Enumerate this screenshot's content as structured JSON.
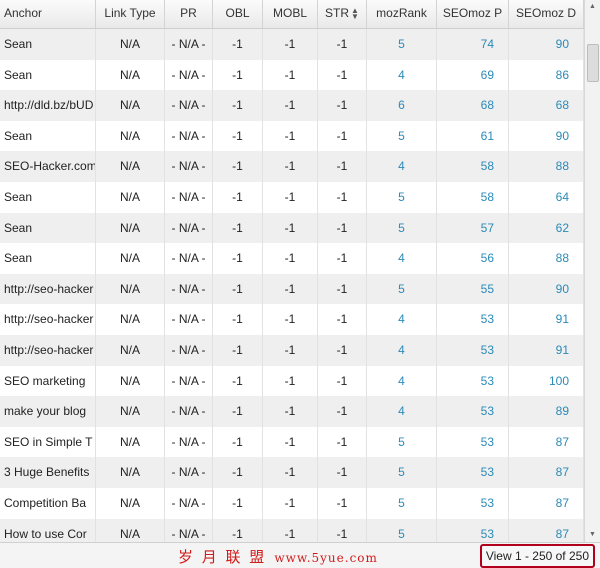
{
  "grid": {
    "columns": [
      {
        "key": "anchor",
        "label": "Anchor",
        "align": "left"
      },
      {
        "key": "link_type",
        "label": "Link Type",
        "align": "center"
      },
      {
        "key": "pr",
        "label": "PR",
        "align": "center"
      },
      {
        "key": "obl",
        "label": "OBL",
        "align": "center"
      },
      {
        "key": "mobl",
        "label": "MOBL",
        "align": "center"
      },
      {
        "key": "str",
        "label": "STR",
        "align": "center",
        "sorted": true
      },
      {
        "key": "mozrank",
        "label": "mozRank",
        "align": "center"
      },
      {
        "key": "seomoz_p",
        "label": "SEOmoz P",
        "align": "right"
      },
      {
        "key": "seomoz_d",
        "label": "SEOmoz D",
        "align": "right"
      }
    ],
    "rows": [
      [
        "Sean",
        "N/A",
        "- N/A -",
        "-1",
        "-1",
        "-1",
        "5",
        "74",
        "90"
      ],
      [
        "Sean",
        "N/A",
        "- N/A -",
        "-1",
        "-1",
        "-1",
        "4",
        "69",
        "86"
      ],
      [
        "http://dld.bz/bUD",
        "N/A",
        "- N/A -",
        "-1",
        "-1",
        "-1",
        "6",
        "68",
        "68"
      ],
      [
        "Sean",
        "N/A",
        "- N/A -",
        "-1",
        "-1",
        "-1",
        "5",
        "61",
        "90"
      ],
      [
        "SEO-Hacker.com",
        "N/A",
        "- N/A -",
        "-1",
        "-1",
        "-1",
        "4",
        "58",
        "88"
      ],
      [
        "Sean",
        "N/A",
        "- N/A -",
        "-1",
        "-1",
        "-1",
        "5",
        "58",
        "64"
      ],
      [
        "Sean",
        "N/A",
        "- N/A -",
        "-1",
        "-1",
        "-1",
        "5",
        "57",
        "62"
      ],
      [
        "Sean",
        "N/A",
        "- N/A -",
        "-1",
        "-1",
        "-1",
        "4",
        "56",
        "88"
      ],
      [
        "http://seo-hacker",
        "N/A",
        "- N/A -",
        "-1",
        "-1",
        "-1",
        "5",
        "55",
        "90"
      ],
      [
        "http://seo-hacker",
        "N/A",
        "- N/A -",
        "-1",
        "-1",
        "-1",
        "4",
        "53",
        "91"
      ],
      [
        "http://seo-hacker",
        "N/A",
        "- N/A -",
        "-1",
        "-1",
        "-1",
        "4",
        "53",
        "91"
      ],
      [
        "SEO marketing",
        "N/A",
        "- N/A -",
        "-1",
        "-1",
        "-1",
        "4",
        "53",
        "100"
      ],
      [
        "make your blog",
        "N/A",
        "- N/A -",
        "-1",
        "-1",
        "-1",
        "4",
        "53",
        "89"
      ],
      [
        "SEO in Simple T",
        "N/A",
        "- N/A -",
        "-1",
        "-1",
        "-1",
        "5",
        "53",
        "87"
      ],
      [
        "3 Huge Benefits",
        "N/A",
        "- N/A -",
        "-1",
        "-1",
        "-1",
        "5",
        "53",
        "87"
      ],
      [
        "Competition Ba",
        "N/A",
        "- N/A -",
        "-1",
        "-1",
        "-1",
        "5",
        "53",
        "87"
      ],
      [
        "How to use Cor",
        "N/A",
        "- N/A -",
        "-1",
        "-1",
        "-1",
        "5",
        "53",
        "87"
      ]
    ]
  },
  "pager": {
    "view_info": "View 1 - 250 of 250",
    "watermark_cn": "岁 月 联 盟",
    "watermark_url": "www.5yue.com"
  },
  "colors": {
    "link": "#2b8ab8",
    "alt_row": "#efefef",
    "highlight_border": "#b0001c",
    "watermark": "#d21c1c"
  }
}
